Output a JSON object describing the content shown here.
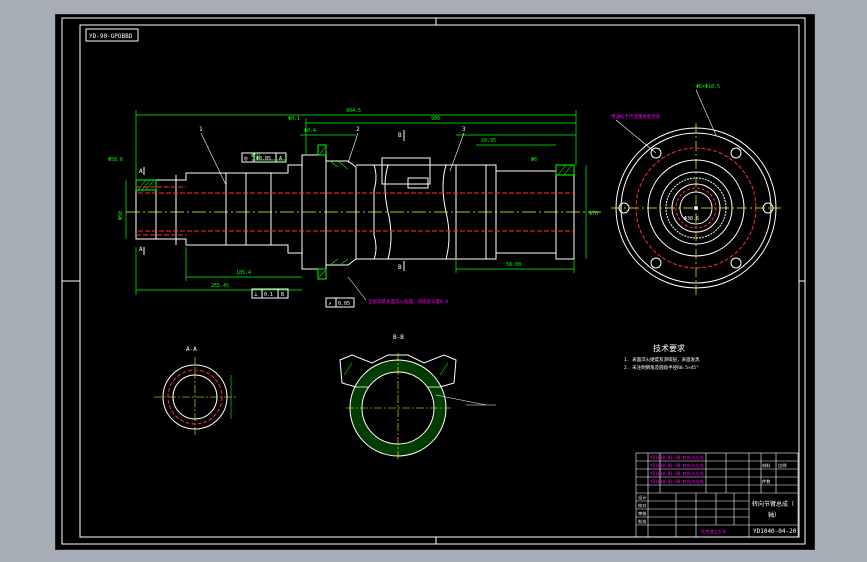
{
  "drawing": {
    "stamp_text": "YD-90-GPOBBD",
    "colors": {
      "background": "#000000",
      "outline": "#ffffff",
      "dimension": "#00ff00",
      "centerline": "#ffff00",
      "hidden": "#ff3030",
      "hatch": "#00ff00",
      "annotation": "#ff00ff",
      "page": "#a7adb6"
    },
    "section_labels": {
      "section_a": "A-A",
      "section_b": "B-B",
      "marker_a": "A",
      "marker_b": "B"
    },
    "dimensions": {
      "overall_length": "904.5",
      "middle_dim": "900",
      "lower_left": "185.4",
      "lower_total": "265.45",
      "left_dia": "Φ58.6",
      "right_top": "Φ6",
      "top_detail": "Φ0.4",
      "top_detail_2": "Φ0.1",
      "note_hole": "Φ6×Φ18.5",
      "dim_20": "20.35",
      "dim_58": "58.00",
      "fit_50": "Φ50",
      "right_flange": "Φ70",
      "bore_label": "Φ30.6"
    },
    "tolerance_frames": [
      {
        "symbol": "◎",
        "value": "Φ0.05",
        "datum": "A"
      },
      {
        "symbol": "⊥",
        "value": "0.1",
        "datum": "B"
      },
      {
        "symbol": "↗",
        "value": "0.05",
        "datum": "A"
      }
    ],
    "tech_requirements": {
      "title": "技术要求",
      "items": [
        "1.  表面淬火硬度及渗碳层，表面发黑",
        "2.  未注明倒角及圆角半径R0.5×45°"
      ]
    },
    "callouts": {
      "leader_note_1": "用油标卡尺测量各配合处",
      "leader_note_2": "全部渗碳表面淬火处理，渗碳层深度0.8",
      "part_1": "1",
      "part_2": "2",
      "part_3": "3"
    },
    "title_block": {
      "drawing_name": "转向节臂总成（",
      "drawing_name_2": "轴）",
      "drawing_number": "YD1040-04-20",
      "revision_rows": [
        "YD1040-01-08 转向节总成",
        "YD1040-01-08 转向节总成",
        "YD1040-01-08 转向节总成",
        "YD1040-01-08 转向节总成"
      ],
      "headers": [
        "材料",
        "比例",
        "件数"
      ],
      "signature_rows": [
        "设计",
        "校对",
        "审核",
        "批准"
      ],
      "org": "北京理工大学"
    }
  }
}
